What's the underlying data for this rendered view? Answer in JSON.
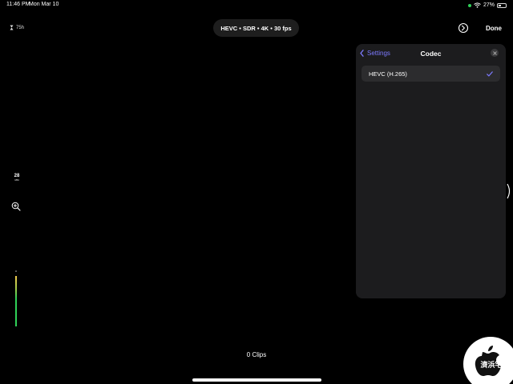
{
  "status_bar": {
    "time": "11:46 PM",
    "date": "Mon Mar 10",
    "battery": "27%"
  },
  "recording": {
    "remaining": "75h"
  },
  "format": {
    "label": "HEVC • SDR • 4K • 30 fps"
  },
  "toolbar": {
    "done_label": "Done"
  },
  "popover": {
    "back_label": "Settings",
    "title": "Codec",
    "options": [
      {
        "label": "HEVC (H.265)",
        "selected": true
      }
    ]
  },
  "lens": {
    "focal_length": "28",
    "unit": "MM"
  },
  "audio": {
    "level": 0.85
  },
  "footer": {
    "clips": "0 Clips"
  },
  "watermark": {
    "text": "濟浜宅"
  },
  "colors": {
    "accent": "#7d7aff",
    "background": "#000000",
    "panel": "#1c1c1e",
    "row": "#2c2c2e",
    "status_green": "#30d158"
  },
  "icons": {
    "remaining": "hourglass-icon",
    "settings": "settings-chevron-icon",
    "back": "chevron-left-icon",
    "close": "close-icon",
    "check": "checkmark-icon",
    "zoom": "zoom-in-icon",
    "wifi": "wifi-icon",
    "battery": "battery-icon"
  }
}
